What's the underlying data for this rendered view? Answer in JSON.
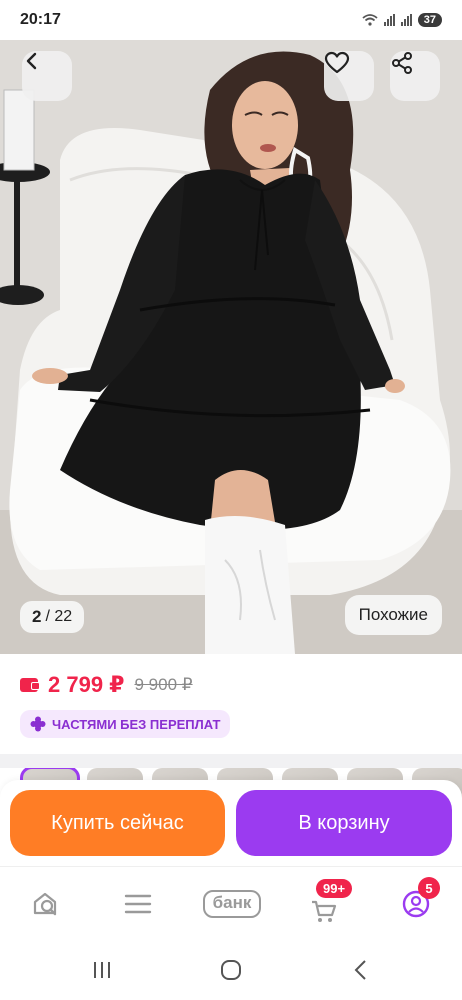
{
  "status_bar": {
    "time": "20:17",
    "battery": "37"
  },
  "gallery": {
    "current": "2",
    "total": "/ 22",
    "similar_label": "Похожие"
  },
  "icons": {
    "back": "back-arrow-icon",
    "favorite": "heart-icon",
    "share": "share-icon"
  },
  "price": {
    "current": "2 799 ₽",
    "old": "9 900 ₽",
    "installment": "ЧАСТЯМИ БЕЗ ПЕРЕПЛАТ"
  },
  "actions": {
    "buy_now": "Купить сейчас",
    "add_to_cart": "В корзину"
  },
  "bottom_nav": {
    "bank_label": "банк",
    "cart_badge": "99+",
    "profile_badge": "5"
  },
  "colors": {
    "price": "#f0244b",
    "buy_button": "#ff7d25",
    "cart_button": "#9b3bf0",
    "installment_bg": "#f5e8fd"
  }
}
